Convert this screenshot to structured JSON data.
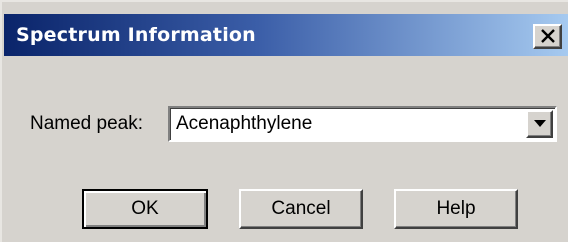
{
  "window": {
    "title": "Spectrum Information",
    "close_icon": "close-icon"
  },
  "form": {
    "named_peak_label": "Named peak:",
    "named_peak_value": "Acenaphthylene",
    "dropdown_icon": "chevron-down-icon"
  },
  "buttons": {
    "ok_label": "OK",
    "cancel_label": "Cancel",
    "help_label": "Help"
  },
  "colors": {
    "titlebar_start": "#0a246a",
    "titlebar_end": "#a6caf0",
    "dialog_face": "#d6d3ce"
  }
}
